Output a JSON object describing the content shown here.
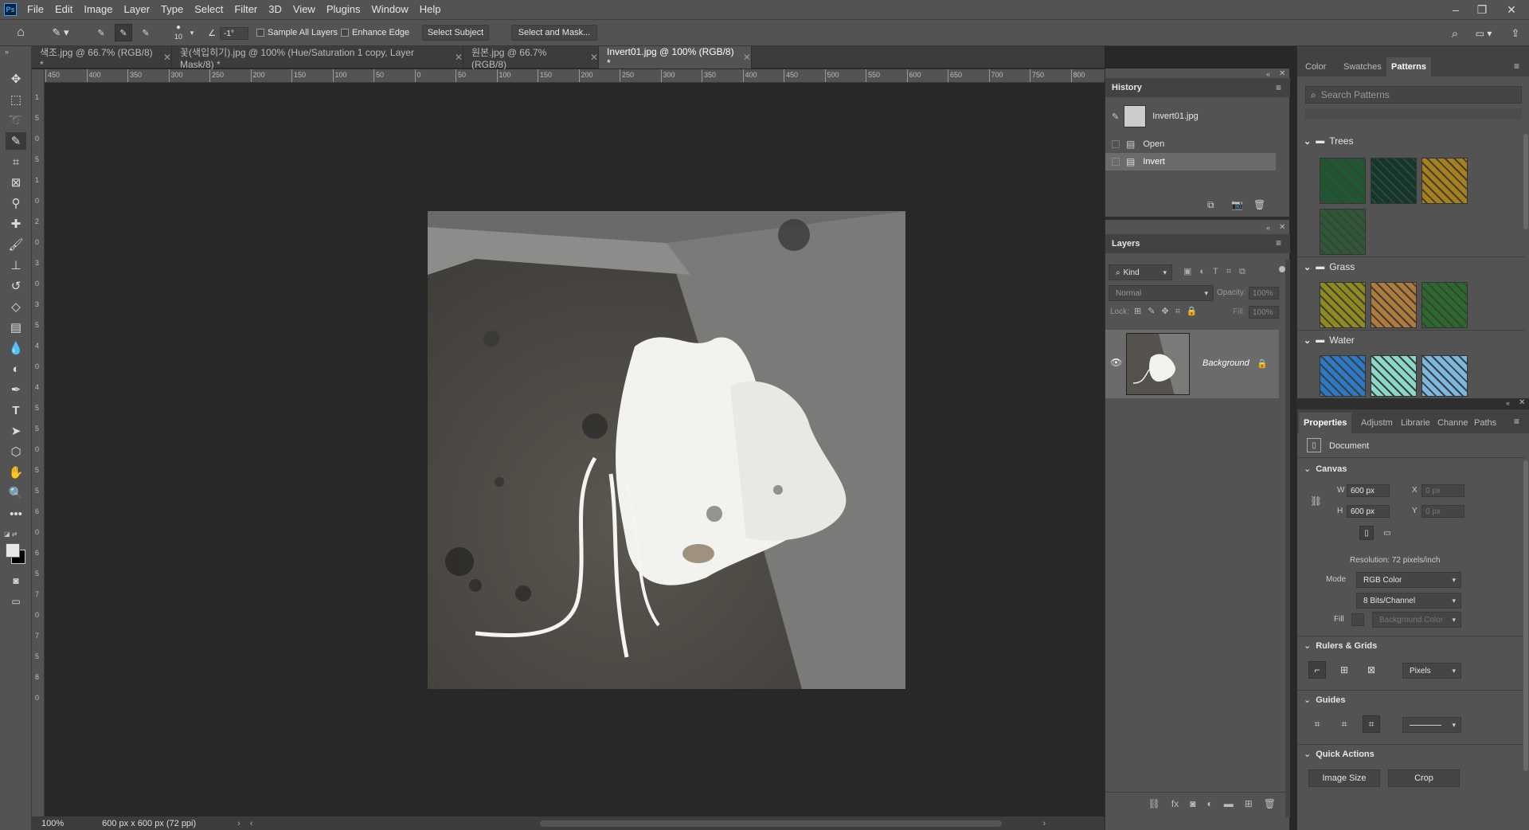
{
  "app": {
    "logo": "Ps"
  },
  "menu": [
    "File",
    "Edit",
    "Image",
    "Layer",
    "Type",
    "Select",
    "Filter",
    "3D",
    "View",
    "Plugins",
    "Window",
    "Help"
  ],
  "options": {
    "brush_size": "10",
    "angle_value": "-1°",
    "sample_all_layers": "Sample All Layers",
    "enhance_edge": "Enhance Edge",
    "select_subject": "Select Subject",
    "select_and_mask": "Select and Mask..."
  },
  "tabs": [
    {
      "label": "색조.jpg @ 66.7% (RGB/8) *"
    },
    {
      "label": "꽃(색입히기).jpg @ 100% (Hue/Saturation 1 copy, Layer Mask/8) *"
    },
    {
      "label": "원본.jpg @ 66.7% (RGB/8)"
    },
    {
      "label": "Invert01.jpg @ 100% (RGB/8) *"
    }
  ],
  "ruler_h": [
    "450",
    "400",
    "350",
    "300",
    "250",
    "200",
    "150",
    "100",
    "50",
    "0",
    "50",
    "100",
    "150",
    "200",
    "250",
    "300",
    "350",
    "400",
    "450",
    "500",
    "550",
    "600",
    "650",
    "700",
    "750",
    "800"
  ],
  "ruler_v": [
    "1",
    "5",
    "0",
    "5",
    "1",
    "0",
    "2",
    "0",
    "3",
    "0",
    "3",
    "5",
    "4",
    "0",
    "4",
    "5",
    "5",
    "0",
    "5",
    "5",
    "6",
    "0",
    "6",
    "5",
    "7",
    "0",
    "7",
    "5",
    "8",
    "0"
  ],
  "status": {
    "zoom": "100%",
    "doc_info": "600 px x 600 px (72 ppi)"
  },
  "history": {
    "title": "History",
    "snapshot": "Invert01.jpg",
    "items": [
      "Open",
      "Invert"
    ]
  },
  "layers": {
    "title": "Layers",
    "filter_kind": "Kind",
    "blend_mode": "Normal",
    "opacity_label": "Opacity:",
    "opacity_value": "100%",
    "lock_label": "Lock:",
    "fill_label": "Fill:",
    "fill_value": "100%",
    "layer_name": "Background"
  },
  "patterns_panel": {
    "tabs": [
      "Color",
      "Swatches",
      "Patterns"
    ],
    "search_placeholder": "Search Patterns",
    "groups": [
      {
        "name": "Trees",
        "swatches": [
          "#1b5a2c",
          "#0f3a2a",
          "#a8801a",
          "#2d5a34"
        ]
      },
      {
        "name": "Grass",
        "swatches": [
          "#8e8a1c",
          "#b07a3a",
          "#2a6a2a"
        ]
      },
      {
        "name": "Water",
        "swatches": [
          "#2a7ac8",
          "#8ad8c8",
          "#7ab8e0"
        ]
      }
    ]
  },
  "properties": {
    "tabs": [
      "Properties",
      "Adjustm",
      "Librarie",
      "Channe",
      "Paths"
    ],
    "doc_label": "Document",
    "canvas_title": "Canvas",
    "w_label": "W",
    "w_value": "600 px",
    "h_label": "H",
    "h_value": "600 px",
    "x_label": "X",
    "x_value": "0 px",
    "y_label": "Y",
    "y_value": "0 px",
    "resolution": "Resolution: 72 pixels/inch",
    "mode_label": "Mode",
    "mode_value": "RGB Color",
    "bits_value": "8 Bits/Channel",
    "fill_label": "Fill",
    "fill_value": "Background Color",
    "rulers_title": "Rulers & Grids",
    "units_value": "Pixels",
    "guides_title": "Guides",
    "quick_title": "Quick Actions",
    "image_size": "Image Size",
    "crop": "Crop"
  }
}
